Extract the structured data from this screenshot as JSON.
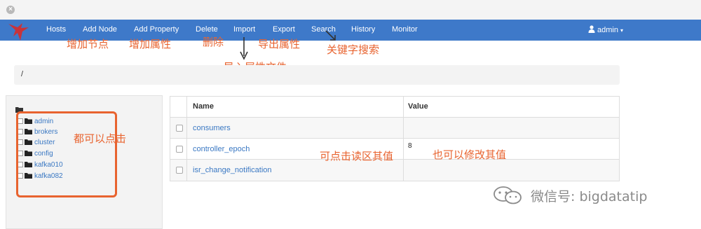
{
  "window": {
    "close_glyph": "×"
  },
  "navbar": {
    "brand_color": "#3e79c9",
    "logo_icon": "bird-logo",
    "items": [
      {
        "label": "Hosts"
      },
      {
        "label": "Add Node"
      },
      {
        "label": "Add Property"
      },
      {
        "label": "Delete"
      },
      {
        "label": "Import"
      },
      {
        "label": "Export"
      },
      {
        "label": "Search"
      },
      {
        "label": "History"
      },
      {
        "label": "Monitor"
      }
    ],
    "user": {
      "label": "admin",
      "icon": "user-icon",
      "caret": "▾"
    }
  },
  "annotations": {
    "color": "#e8632f",
    "add_node": "增加节点",
    "add_property": "增加属性",
    "delete": "删除",
    "export": "导出属性",
    "search": "关键字搜索",
    "import": "导入属性文件",
    "tree_clickable": "都可以点击",
    "value_readable": "可点击读区其值",
    "value_editable": "也可以修改其值"
  },
  "breadcrumb": {
    "path": "/"
  },
  "tree": {
    "root_icon": "folder-open-icon",
    "items": [
      {
        "label": "admin"
      },
      {
        "label": "brokers"
      },
      {
        "label": "cluster"
      },
      {
        "label": "config"
      },
      {
        "label": "kafka010"
      },
      {
        "label": "kafka082"
      }
    ]
  },
  "table": {
    "headers": {
      "name": "Name",
      "value": "Value"
    },
    "rows": [
      {
        "name": "consumers",
        "value": ""
      },
      {
        "name": "controller_epoch",
        "value": "8"
      },
      {
        "name": "isr_change_notification",
        "value": ""
      }
    ]
  },
  "watermark": {
    "text": "微信号: bigdatatip",
    "icon": "wechat-icon"
  }
}
